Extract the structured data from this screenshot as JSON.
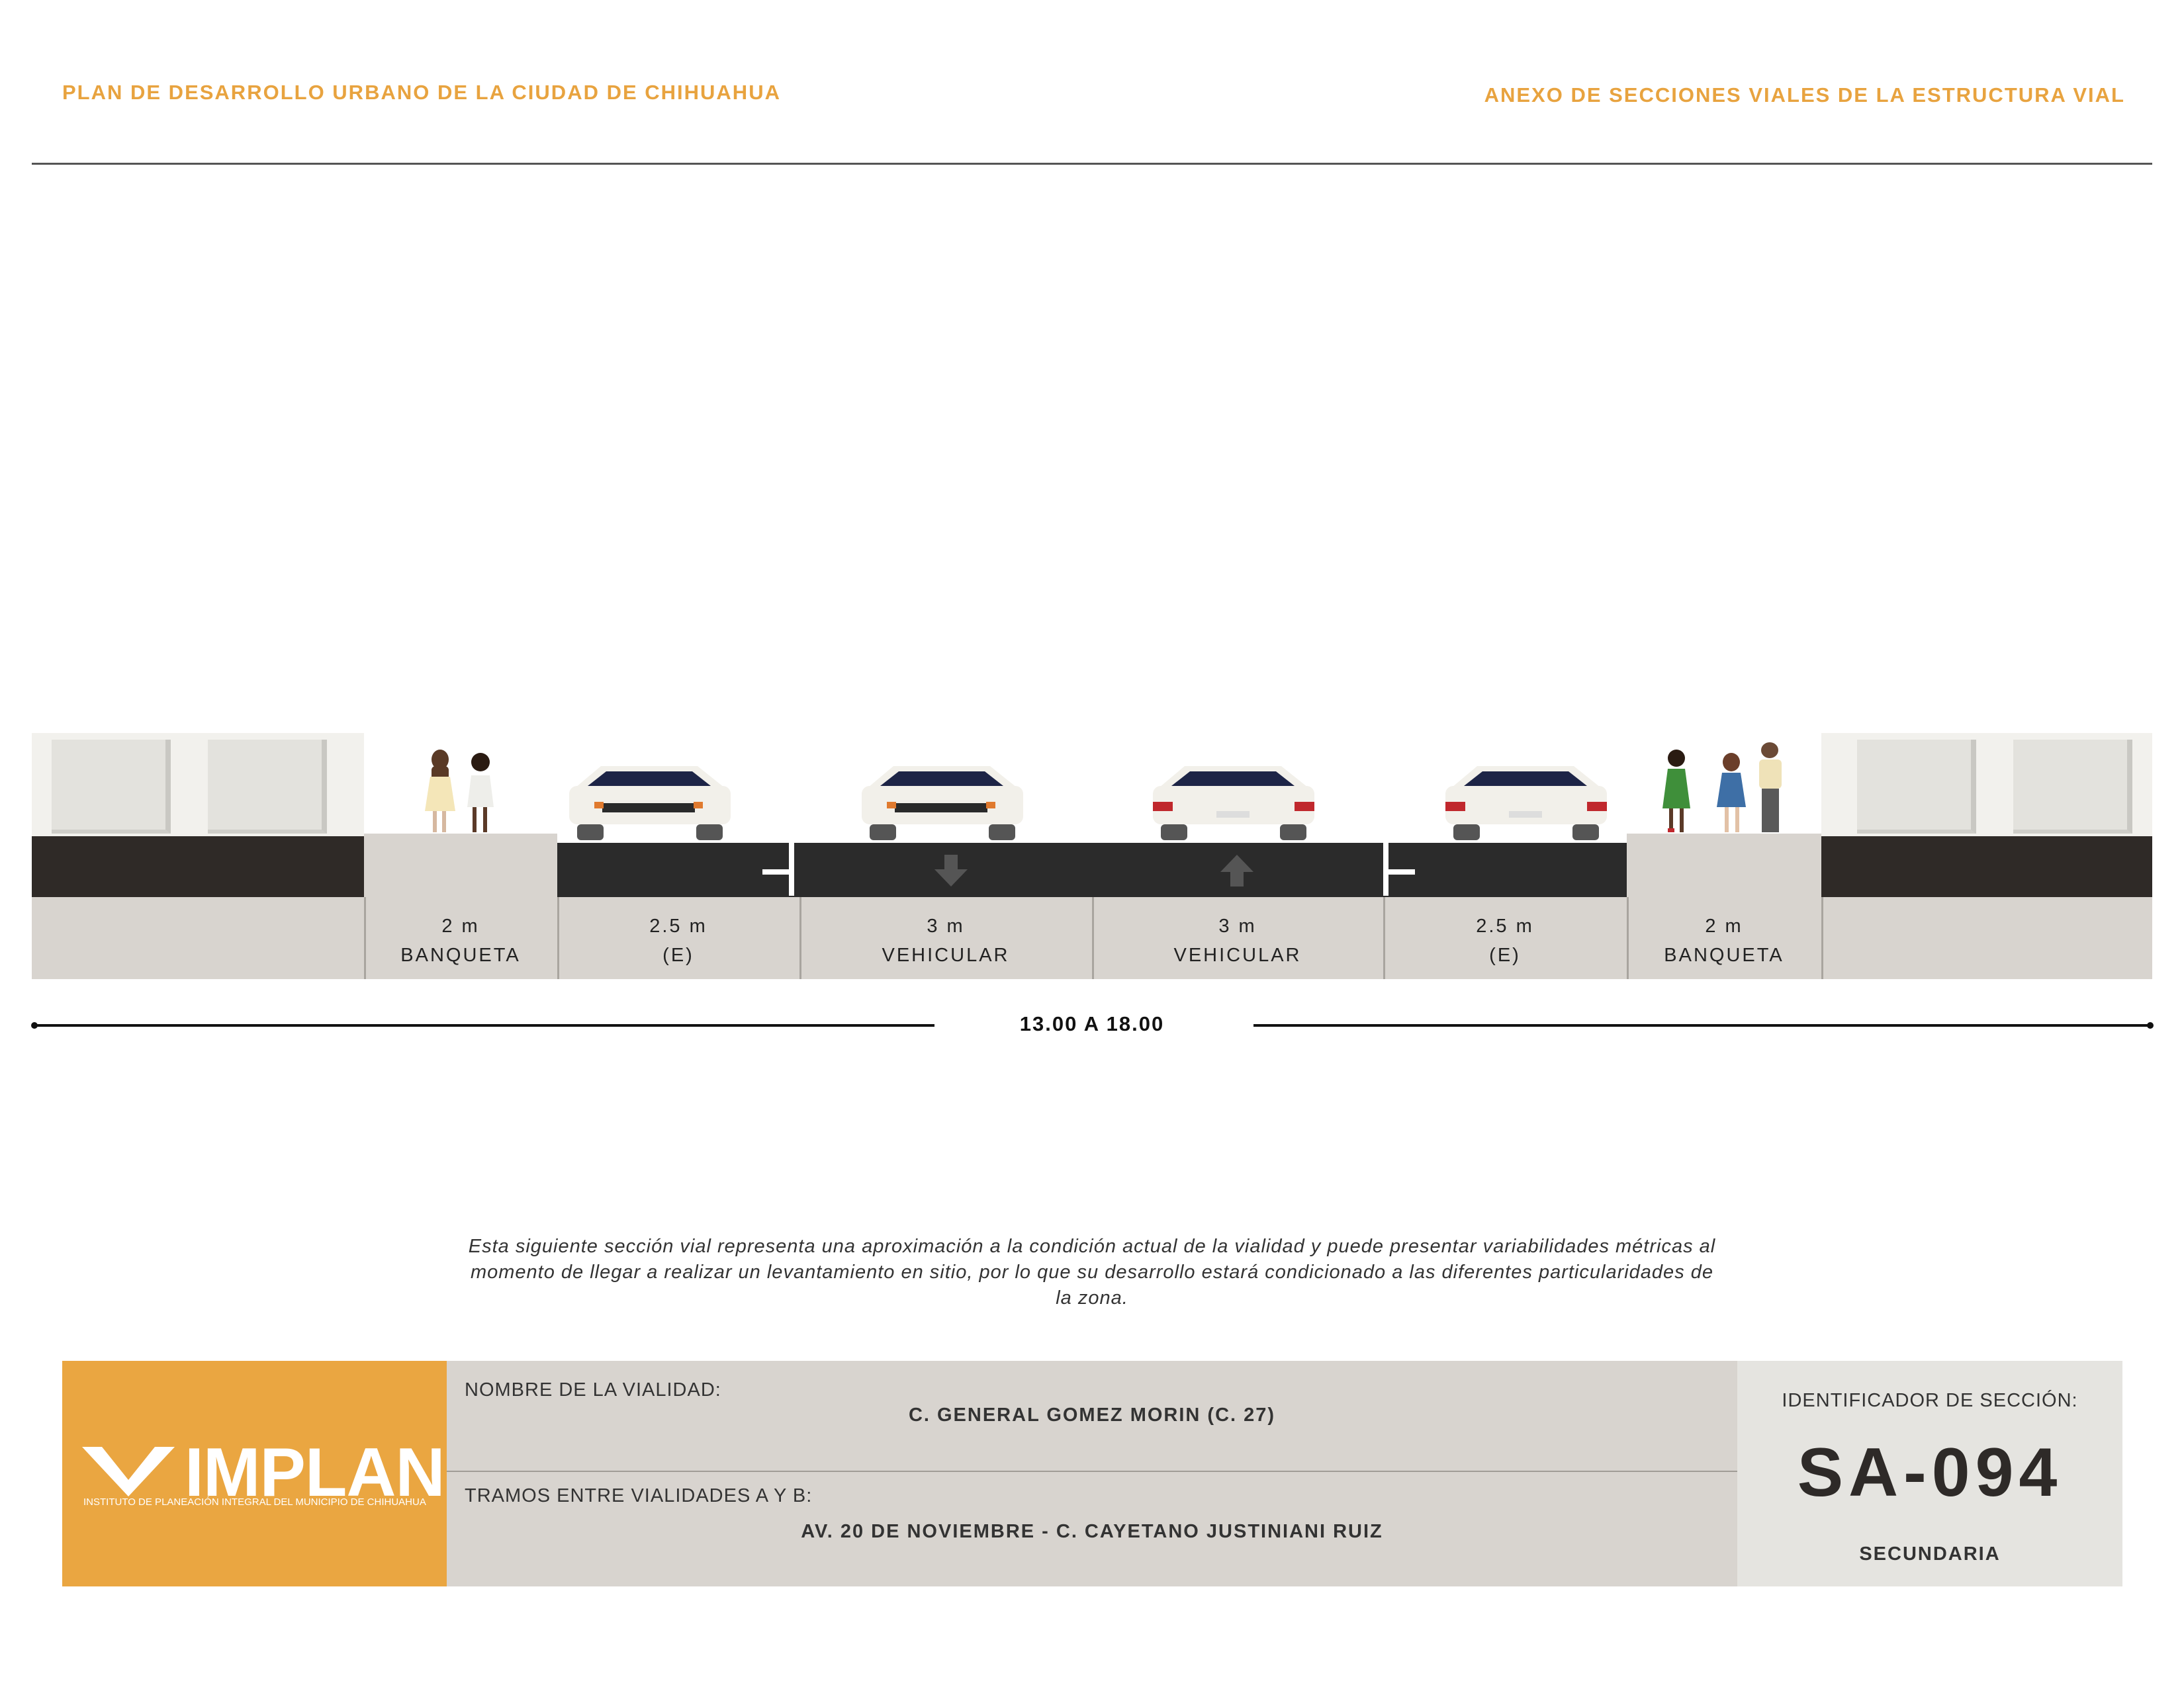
{
  "header": {
    "left_title": "PLAN DE DESARROLLO URBANO DE LA CIUDAD DE CHIHUAHUA",
    "right_title": "ANEXO DE SECCIONES VIALES DE LA ESTRUCTURA VIAL"
  },
  "section": {
    "segments": [
      {
        "width": "2 m",
        "label": "BANQUETA"
      },
      {
        "width": "2.5 m",
        "label": "(E)"
      },
      {
        "width": "3 m",
        "label": "VEHICULAR"
      },
      {
        "width": "3 m",
        "label": "VEHICULAR"
      },
      {
        "width": "2.5 m",
        "label": "(E)"
      },
      {
        "width": "2 m",
        "label": "BANQUETA"
      }
    ],
    "total_width": "13.00 A 18.00"
  },
  "note": "Esta siguiente sección vial representa una aproximación a la condición actual de la vialidad y puede presentar variabilidades métricas al momento de llegar a realizar un levantamiento en sitio, por lo que su desarrollo estará condicionado a las diferentes particularidades de la zona.",
  "info": {
    "logo_text": "IMPLAN",
    "logo_subtitle": "INSTITUTO DE PLANEACIÓN INTEGRAL DEL MUNICIPIO DE CHIHUAHUA",
    "road_name_label": "NOMBRE DE LA VIALIDAD:",
    "road_name": "C. GENERAL GOMEZ MORIN (C. 27)",
    "segment_label": "TRAMOS ENTRE VIALIDADES A Y B:",
    "segment_value": "AV. 20 DE NOVIEMBRE - C. CAYETANO JUSTINIANI RUIZ",
    "id_label": "IDENTIFICADOR DE SECCIÓN:",
    "id_value": "SA-094",
    "classification": "SECUNDARIA"
  },
  "colors": {
    "accent": "#e8a33f",
    "asphalt": "#2b2b2b",
    "sidewalk": "#d8d4cf"
  }
}
